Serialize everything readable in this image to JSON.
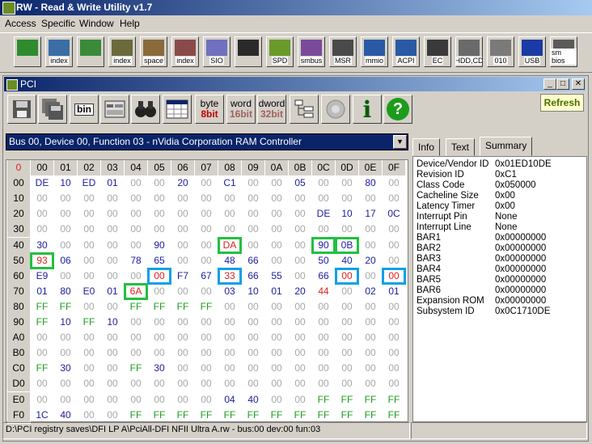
{
  "window": {
    "title": "RW - Read & Write Utility v1.7"
  },
  "menu": [
    "Access",
    "Specific",
    "Window",
    "Help"
  ],
  "toolbar": [
    {
      "icon": "pci-card-icon",
      "label": ""
    },
    {
      "icon": "pci-index-icon",
      "label": "index"
    },
    {
      "icon": "memory-icon",
      "label": ""
    },
    {
      "icon": "memory-index-icon",
      "label": "index"
    },
    {
      "icon": "io-space-icon",
      "label": "space"
    },
    {
      "icon": "io-index-icon",
      "label": "index"
    },
    {
      "icon": "sio-icon",
      "label": "SIO"
    },
    {
      "icon": "oscilloscope-icon",
      "label": ""
    },
    {
      "icon": "spd-icon",
      "label": "SPD"
    },
    {
      "icon": "smbus-icon",
      "label": "smbus"
    },
    {
      "icon": "msr-icon",
      "label": "MSR"
    },
    {
      "icon": "mmio-icon",
      "label": "mmio"
    },
    {
      "icon": "acpi-icon",
      "label": "ACPI"
    },
    {
      "icon": "ec-icon",
      "label": "EC"
    },
    {
      "icon": "hdd-cd-icon",
      "label": "HDD,CD"
    },
    {
      "icon": "floppy-010-icon",
      "label": "010"
    },
    {
      "icon": "usb-icon",
      "label": "USB"
    },
    {
      "icon": "smbios-icon",
      "label": "sm bios"
    }
  ],
  "child": {
    "title": "PCI",
    "buttons": {
      "byte": [
        "byte",
        "8bit"
      ],
      "word": [
        "word",
        "16bit"
      ],
      "dword": [
        "dword",
        "32bit"
      ],
      "bin": "bin",
      "info": "i",
      "help": "?"
    },
    "refresh": "Refresh",
    "device": "Bus 00, Device 00, Function 03 - nVidia Corporation RAM Controller",
    "tabs": [
      "Info",
      "Text",
      "Summary"
    ],
    "status_path": "D:\\PCI registry saves\\DFI LP A\\PciAll-DFI NFII Ultra A.rw - bus:00 dev:00 fun:03"
  },
  "grid": {
    "corner": "0",
    "columns": [
      "00",
      "01",
      "02",
      "03",
      "04",
      "05",
      "06",
      "07",
      "08",
      "09",
      "0A",
      "0B",
      "0C",
      "0D",
      "0E",
      "0F"
    ],
    "rows": [
      {
        "addr": "00",
        "v": [
          "DE",
          "10",
          "ED",
          "01",
          "00",
          "00",
          "20",
          "00",
          "C1",
          "00",
          "00",
          "05",
          "00",
          "00",
          "80",
          "00"
        ]
      },
      {
        "addr": "10",
        "v": [
          "00",
          "00",
          "00",
          "00",
          "00",
          "00",
          "00",
          "00",
          "00",
          "00",
          "00",
          "00",
          "00",
          "00",
          "00",
          "00"
        ]
      },
      {
        "addr": "20",
        "v": [
          "00",
          "00",
          "00",
          "00",
          "00",
          "00",
          "00",
          "00",
          "00",
          "00",
          "00",
          "00",
          "DE",
          "10",
          "17",
          "0C"
        ]
      },
      {
        "addr": "30",
        "v": [
          "00",
          "00",
          "00",
          "00",
          "00",
          "00",
          "00",
          "00",
          "00",
          "00",
          "00",
          "00",
          "00",
          "00",
          "00",
          "00"
        ]
      },
      {
        "addr": "40",
        "v": [
          "30",
          "00",
          "00",
          "00",
          "00",
          "90",
          "00",
          "00",
          "DA",
          "00",
          "00",
          "00",
          "90",
          "0B",
          "00",
          "00"
        ]
      },
      {
        "addr": "50",
        "v": [
          "93",
          "06",
          "00",
          "00",
          "78",
          "65",
          "00",
          "00",
          "48",
          "66",
          "00",
          "00",
          "50",
          "40",
          "20",
          "00"
        ]
      },
      {
        "addr": "60",
        "v": [
          "E9",
          "00",
          "00",
          "00",
          "00",
          "00",
          "F7",
          "67",
          "33",
          "66",
          "55",
          "00",
          "66",
          "00",
          "00",
          "00"
        ]
      },
      {
        "addr": "70",
        "v": [
          "01",
          "80",
          "E0",
          "01",
          "6A",
          "00",
          "00",
          "00",
          "03",
          "10",
          "01",
          "20",
          "44",
          "00",
          "02",
          "01"
        ]
      },
      {
        "addr": "80",
        "v": [
          "FF",
          "FF",
          "00",
          "00",
          "FF",
          "FF",
          "FF",
          "FF",
          "00",
          "00",
          "00",
          "00",
          "00",
          "00",
          "00",
          "00"
        ]
      },
      {
        "addr": "90",
        "v": [
          "FF",
          "10",
          "FF",
          "10",
          "00",
          "00",
          "00",
          "00",
          "00",
          "00",
          "00",
          "00",
          "00",
          "00",
          "00",
          "00"
        ]
      },
      {
        "addr": "A0",
        "v": [
          "00",
          "00",
          "00",
          "00",
          "00",
          "00",
          "00",
          "00",
          "00",
          "00",
          "00",
          "00",
          "00",
          "00",
          "00",
          "00"
        ]
      },
      {
        "addr": "B0",
        "v": [
          "00",
          "00",
          "00",
          "00",
          "00",
          "00",
          "00",
          "00",
          "00",
          "00",
          "00",
          "00",
          "00",
          "00",
          "00",
          "00"
        ]
      },
      {
        "addr": "C0",
        "v": [
          "FF",
          "30",
          "00",
          "00",
          "FF",
          "30",
          "00",
          "00",
          "00",
          "00",
          "00",
          "00",
          "00",
          "00",
          "00",
          "00"
        ]
      },
      {
        "addr": "D0",
        "v": [
          "00",
          "00",
          "00",
          "00",
          "00",
          "00",
          "00",
          "00",
          "00",
          "00",
          "00",
          "00",
          "00",
          "00",
          "00",
          "00"
        ]
      },
      {
        "addr": "E0",
        "v": [
          "00",
          "00",
          "00",
          "00",
          "00",
          "00",
          "00",
          "00",
          "04",
          "40",
          "00",
          "00",
          "FF",
          "FF",
          "FF",
          "FF"
        ]
      },
      {
        "addr": "F0",
        "v": [
          "1C",
          "40",
          "00",
          "00",
          "FF",
          "FF",
          "FF",
          "FF",
          "FF",
          "FF",
          "FF",
          "FF",
          "FF",
          "FF",
          "FF",
          "FF"
        ]
      }
    ],
    "red_cells": [
      [
        4,
        8
      ],
      [
        5,
        0
      ],
      [
        6,
        5
      ],
      [
        6,
        8
      ],
      [
        6,
        13
      ],
      [
        6,
        15
      ],
      [
        7,
        4
      ],
      [
        7,
        12
      ]
    ],
    "green_boxes": [
      [
        4,
        8
      ],
      [
        4,
        12
      ],
      [
        4,
        13
      ],
      [
        5,
        0
      ],
      [
        7,
        4
      ]
    ],
    "blue_boxes": [
      [
        6,
        5
      ],
      [
        6,
        8
      ],
      [
        6,
        13
      ],
      [
        6,
        15
      ]
    ],
    "colors": {
      "value": "#1c1c9c",
      "zero": "#a8a8a8",
      "ff": "#1c9c1c",
      "changed": "#e02020",
      "green": "#22c040",
      "blue": "#10a0e8"
    }
  },
  "summary": [
    {
      "k": "Device/Vendor ID",
      "v": "0x01ED10DE"
    },
    {
      "k": "Revision ID",
      "v": "0xC1"
    },
    {
      "k": "Class Code",
      "v": "0x050000"
    },
    {
      "k": "Cacheline Size",
      "v": "0x00"
    },
    {
      "k": "Latency Timer",
      "v": "0x00"
    },
    {
      "k": "Interrupt Pin",
      "v": "None"
    },
    {
      "k": "Interrupt Line",
      "v": "None"
    },
    {
      "k": "BAR1",
      "v": "0x00000000"
    },
    {
      "k": "BAR2",
      "v": "0x00000000"
    },
    {
      "k": "BAR3",
      "v": "0x00000000"
    },
    {
      "k": "BAR4",
      "v": "0x00000000"
    },
    {
      "k": "BAR5",
      "v": "0x00000000"
    },
    {
      "k": "BAR6",
      "v": "0x00000000"
    },
    {
      "k": "Expansion ROM",
      "v": "0x00000000"
    },
    {
      "k": "Subsystem ID",
      "v": "0x0C1710DE"
    }
  ]
}
